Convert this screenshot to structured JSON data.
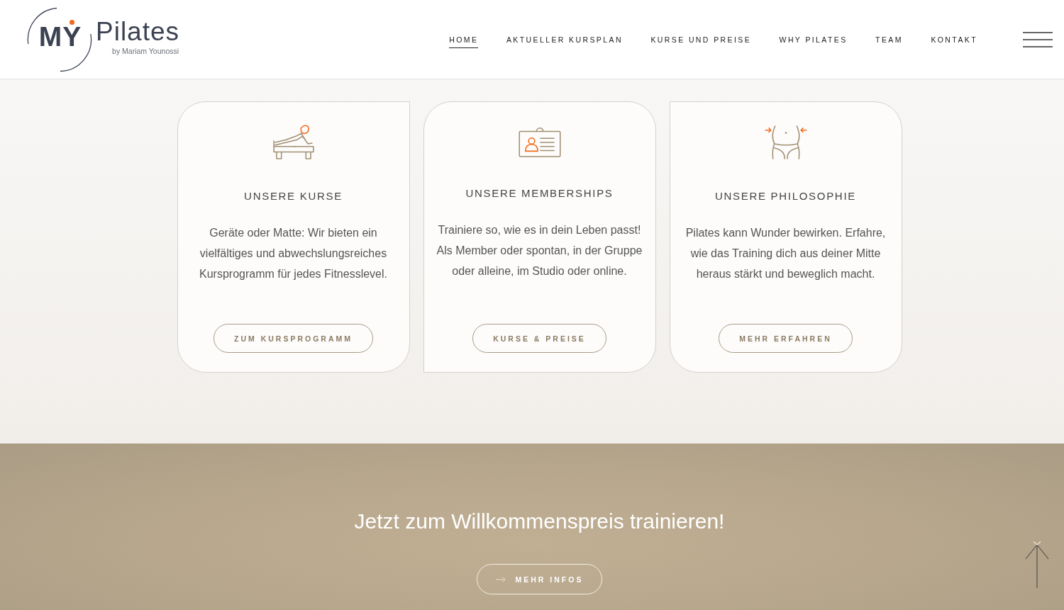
{
  "header": {
    "logo": {
      "mark": "MY",
      "name": "Pilates",
      "tagline": "by Mariam Younossi"
    },
    "nav": [
      {
        "label": "HOME",
        "selected": true
      },
      {
        "label": "AKTUELLER KURSPLAN",
        "selected": false
      },
      {
        "label": "KURSE UND PREISE",
        "selected": false
      },
      {
        "label": "WHY PILATES",
        "selected": false
      },
      {
        "label": "TEAM",
        "selected": false
      },
      {
        "label": "KONTAKT",
        "selected": false
      }
    ]
  },
  "cards": [
    {
      "title": "UNSERE KURSE",
      "text_lines": [
        "Geräte oder Matte: Wir bieten ein",
        "vielfältiges und abwechslungsreiches",
        "Kursprogramm für jedes Fitnesslevel."
      ],
      "button": "ZUM KURSPROGRAMM"
    },
    {
      "title": "UNSERE MEMBERSHIPS",
      "text_lines": [
        "Trainiere so, wie es in dein Leben passt!",
        "Als Member oder spontan, in der Gruppe",
        "oder alleine, im Studio oder online."
      ],
      "button": "KURSE & PREISE"
    },
    {
      "title": "UNSERE PHILOSOPHIE",
      "text_lines": [
        "Pilates kann Wunder bewirken. Erfahre,",
        "wie das Training dich aus deiner Mitte",
        "heraus stärkt und beweglich macht."
      ],
      "button": "MEHR ERFAHREN"
    }
  ],
  "promo": {
    "heading": "Jetzt zum Willkommenspreis trainieren!",
    "button": "MEHR INFOS"
  }
}
